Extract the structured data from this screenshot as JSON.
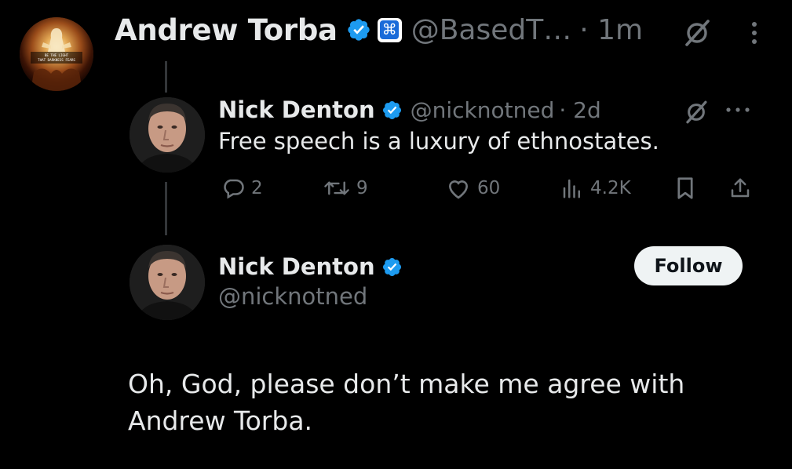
{
  "main_post": {
    "author_name": "Andrew Torba",
    "handle": "@BasedT…",
    "time": "· 1m",
    "avatar_text": [
      "BE THE LIGHT",
      "THAT DARKNESS FEARS"
    ],
    "affiliate_badge_icon": "⌘",
    "body_lines": [
      "Oh, God, please don’t make me agree with",
      "Andrew Torba."
    ]
  },
  "quoted_post": {
    "author_name": "Nick Denton",
    "handle": "@nicknotned",
    "time": "· 2d",
    "text": "Free speech is a luxury of ethnostates.",
    "actions": {
      "replies": "2",
      "reposts": "9",
      "likes": "60",
      "views": "4.2K"
    }
  },
  "profile_card": {
    "name": "Nick Denton",
    "handle": "@nicknotned",
    "follow_label": "Follow"
  },
  "icons": {
    "verified": "verified-badge-icon",
    "grok": "grok-icon",
    "more": "more-icon",
    "reply": "reply-icon",
    "repost": "repost-icon",
    "like": "like-icon",
    "views": "views-icon",
    "bookmark": "bookmark-icon",
    "share": "share-icon"
  },
  "colors": {
    "background": "#000000",
    "primary_text": "#e7e9ea",
    "secondary_text": "#71767b",
    "verified_blue": "#1d9bf0",
    "follow_button_bg": "#eff3f4"
  }
}
